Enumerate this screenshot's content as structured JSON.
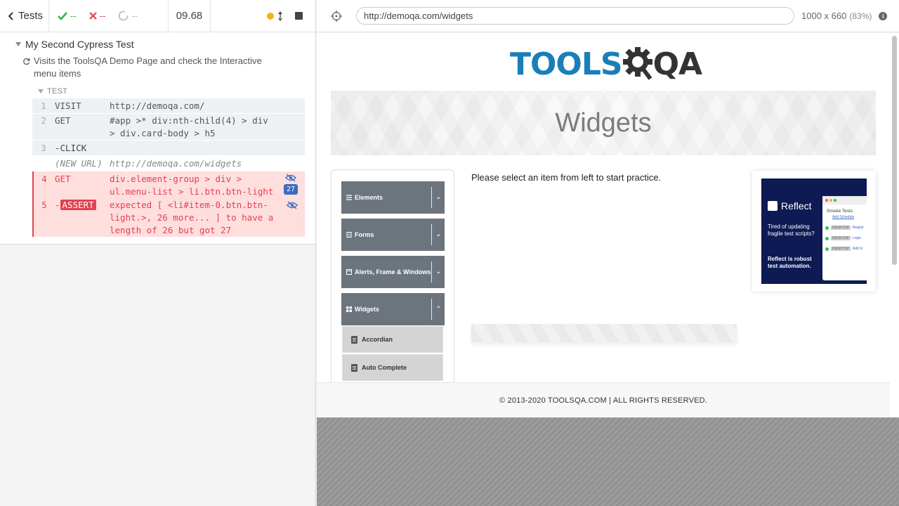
{
  "reporter": {
    "tests_label": "Tests",
    "passed": "--",
    "failed": "--",
    "pending": "--",
    "duration": "09.68",
    "suite_title": "My Second Cypress Test",
    "runnable_title": "Visits the ToolsQA Demo Page and check the Interactive menu items",
    "test_header": "TEST",
    "commands": [
      {
        "num": "1",
        "name": "VISIT",
        "message": "http://demoqa.com/"
      },
      {
        "num": "2",
        "name": "GET",
        "message": "#app >* div:nth-child(4) > div > div.card-body > h5"
      },
      {
        "num": "3",
        "name": "-CLICK",
        "message": ""
      },
      {
        "num": "",
        "name": "(NEW URL)",
        "message": "http://demoqa.com/widgets"
      },
      {
        "num": "4",
        "name": "GET",
        "message": "div.element-group > div > ul.menu-list > li.btn.btn-light",
        "count": "27"
      },
      {
        "num": "5",
        "name_prefix": "-",
        "name": "ASSERT",
        "message": "expected [ <li#item-0.btn.btn-light.>, 26 more... ] to have a length of 26 but got 27"
      }
    ]
  },
  "aut": {
    "url": "http://demoqa.com/widgets",
    "viewport": "1000 x 660",
    "zoom": "(83%)",
    "logo_left": "TOOLS",
    "logo_right": "QA",
    "page_title": "Widgets",
    "groups": [
      {
        "label": "Elements",
        "icon": "list-icon"
      },
      {
        "label": "Forms",
        "icon": "doc-icon"
      },
      {
        "label": "Alerts, Frame & Windows",
        "icon": "window-icon"
      },
      {
        "label": "Widgets",
        "icon": "grid-icon"
      }
    ],
    "widget_items": [
      "Accordian",
      "Auto Complete"
    ],
    "practice_text": "Please select an item from left to start practice.",
    "ad": {
      "brand": "Reflect",
      "line1": "Tired of updating fragile test scripts?",
      "line2": "Reflect is robust test automation.",
      "app_title": "Smoke Tests",
      "add_link": "Add Schedule",
      "rows": [
        "Registr",
        "Login",
        "Add to"
      ],
      "tag": "DESKTOP"
    },
    "footer": "© 2013-2020 TOOLSQA.COM | ALL RIGHTS RESERVED."
  },
  "colors": {
    "pass": "#2fb14a",
    "fail": "#e1424f",
    "running": "#f6b31b",
    "logo_blue": "#1a7fb8",
    "menu_gray": "#6c757d",
    "ad_navy": "#0d1a54"
  }
}
